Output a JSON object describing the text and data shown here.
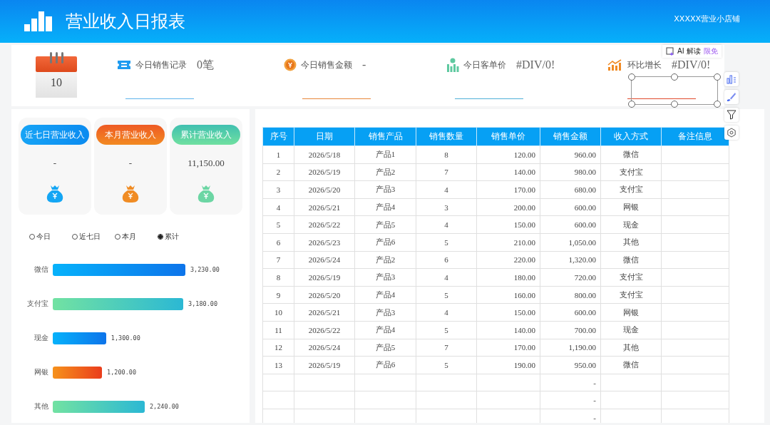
{
  "header": {
    "title": "营业收入日报表",
    "shop": "XXXXX营业小店铺"
  },
  "calendar": {
    "day": "10"
  },
  "kpis": [
    {
      "kind": "records",
      "label": "今日销售记录",
      "value": "0笔"
    },
    {
      "kind": "amount",
      "label": "今日销售金额",
      "value": "-"
    },
    {
      "kind": "unit",
      "label": "今日客单价",
      "value": "#DIV/0!"
    },
    {
      "kind": "growth",
      "label": "环比增长",
      "value": "#DIV/0!"
    }
  ],
  "ai_popup": {
    "label": "AI 解读",
    "badge": "限免"
  },
  "summary_cards": [
    {
      "kind": "blue",
      "title": "近七日营业收入",
      "value": "-"
    },
    {
      "kind": "orange",
      "title": "本月营业收入",
      "value": "-"
    },
    {
      "kind": "green",
      "title": "累计营业收入",
      "value": "11,150.00"
    }
  ],
  "period_options": [
    {
      "label": "今日",
      "selected": false
    },
    {
      "label": "近七日",
      "selected": false
    },
    {
      "label": "本月",
      "selected": false
    },
    {
      "label": "累计",
      "selected": true
    }
  ],
  "method_chart": {
    "chart_data": {
      "type": "bar",
      "orientation": "horizontal",
      "categories": [
        "微信",
        "支付宝",
        "现金",
        "网银",
        "其他"
      ],
      "values": [
        3230,
        3180,
        1300,
        1200,
        2240
      ],
      "value_labels": [
        "3,230.00",
        "3,180.00",
        "1,300.00",
        "1,200.00",
        "2,240.00"
      ]
    }
  },
  "table": {
    "columns": [
      "序号",
      "日期",
      "销售产品",
      "销售数量",
      "销售单价",
      "销售金额",
      "收入方式",
      "备注信息"
    ],
    "rows": [
      [
        "1",
        "2026/5/18",
        "产品1",
        "8",
        "120.00",
        "960.00",
        "微信"
      ],
      [
        "2",
        "2026/5/19",
        "产品2",
        "7",
        "140.00",
        "980.00",
        "支付宝"
      ],
      [
        "3",
        "2026/5/20",
        "产品3",
        "4",
        "170.00",
        "680.00",
        "支付宝"
      ],
      [
        "4",
        "2026/5/21",
        "产品4",
        "3",
        "200.00",
        "600.00",
        "网银"
      ],
      [
        "5",
        "2026/5/22",
        "产品5",
        "4",
        "150.00",
        "600.00",
        "现金"
      ],
      [
        "6",
        "2026/5/23",
        "产品6",
        "5",
        "210.00",
        "1,050.00",
        "其他"
      ],
      [
        "7",
        "2026/5/24",
        "产品2",
        "6",
        "220.00",
        "1,320.00",
        "微信"
      ],
      [
        "8",
        "2026/5/19",
        "产品3",
        "4",
        "180.00",
        "720.00",
        "支付宝"
      ],
      [
        "9",
        "2026/5/20",
        "产品4",
        "5",
        "160.00",
        "800.00",
        "支付宝"
      ],
      [
        "10",
        "2026/5/21",
        "产品3",
        "4",
        "150.00",
        "600.00",
        "网银"
      ],
      [
        "11",
        "2026/5/22",
        "产品4",
        "5",
        "140.00",
        "700.00",
        "现金"
      ],
      [
        "12",
        "2026/5/24",
        "产品5",
        "7",
        "170.00",
        "1,190.00",
        "其他"
      ],
      [
        "13",
        "2026/5/19",
        "产品6",
        "5",
        "190.00",
        "950.00",
        "微信"
      ],
      [
        "",
        "",
        "",
        "",
        "",
        "-",
        ""
      ],
      [
        "",
        "",
        "",
        "",
        "",
        "-",
        ""
      ],
      [
        "",
        "",
        "",
        "",
        "",
        "-",
        ""
      ]
    ]
  }
}
